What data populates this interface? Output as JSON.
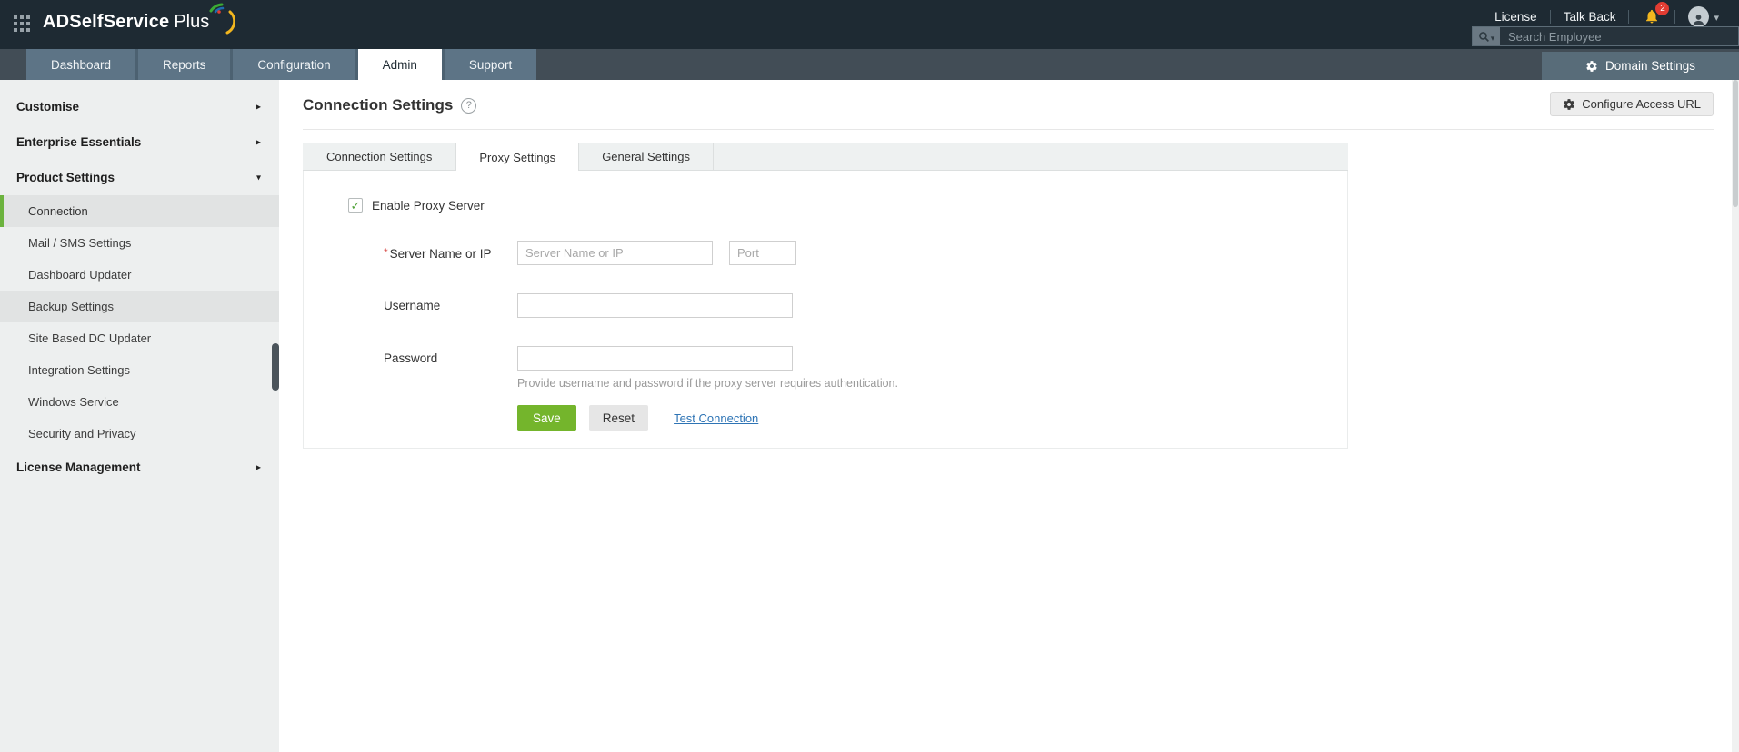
{
  "colors": {
    "header_bg": "#1e2a33",
    "nav_bg": "#424d56",
    "nav_tab_bg": "#5d7486",
    "accent_green": "#6cb33e",
    "save_green": "#74b52c",
    "link_blue": "#2e74b5",
    "badge_red": "#e23c32",
    "bell_yellow": "#f2b61e"
  },
  "header": {
    "brand_bold": "ADSelfService",
    "brand_light": "Plus",
    "license_label": "License",
    "talkback_label": "Talk Back",
    "notification_count": "2",
    "search_placeholder": "Search Employee",
    "domain_settings_label": "Domain Settings"
  },
  "nav": {
    "tabs": [
      {
        "label": "Dashboard",
        "active": false
      },
      {
        "label": "Reports",
        "active": false
      },
      {
        "label": "Configuration",
        "active": false
      },
      {
        "label": "Admin",
        "active": true
      },
      {
        "label": "Support",
        "active": false
      }
    ]
  },
  "sidebar": {
    "items": [
      {
        "label": "Customise",
        "type": "section",
        "chevron": "right"
      },
      {
        "label": "Enterprise Essentials",
        "type": "section",
        "chevron": "right"
      },
      {
        "label": "Product Settings",
        "type": "section",
        "chevron": "down"
      },
      {
        "label": "Connection",
        "type": "sub",
        "state": "active"
      },
      {
        "label": "Mail / SMS Settings",
        "type": "sub",
        "state": ""
      },
      {
        "label": "Dashboard Updater",
        "type": "sub",
        "state": ""
      },
      {
        "label": "Backup Settings",
        "type": "sub",
        "state": "hover"
      },
      {
        "label": "Site Based DC Updater",
        "type": "sub",
        "state": ""
      },
      {
        "label": "Integration Settings",
        "type": "sub",
        "state": ""
      },
      {
        "label": "Windows Service",
        "type": "sub",
        "state": ""
      },
      {
        "label": "Security and Privacy",
        "type": "sub",
        "state": ""
      },
      {
        "label": "License Management",
        "type": "section",
        "chevron": "right"
      }
    ]
  },
  "main": {
    "title": "Connection Settings",
    "configure_access_url_label": "Configure Access URL",
    "tabs": [
      {
        "label": "Connection Settings",
        "active": false
      },
      {
        "label": "Proxy Settings",
        "active": true
      },
      {
        "label": "General Settings",
        "active": false
      }
    ],
    "form": {
      "enable_proxy_label": "Enable Proxy Server",
      "server_label": "Server Name or IP",
      "server_placeholder": "Server Name or IP",
      "port_placeholder": "Port",
      "username_label": "Username",
      "username_value": "",
      "password_label": "Password",
      "password_value": "",
      "helper_text": "Provide username and password if the proxy server requires authentication.",
      "save_label": "Save",
      "reset_label": "Reset",
      "test_connection_label": "Test Connection"
    }
  }
}
